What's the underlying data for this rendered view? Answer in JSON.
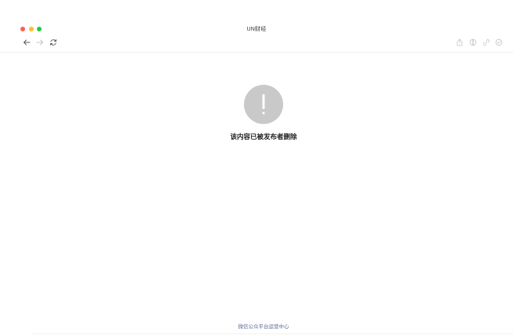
{
  "window": {
    "title": "UN财经",
    "traffic_colors": {
      "close": "#fe5f57",
      "minimize": "#febc2e",
      "maximize": "#28c840"
    }
  },
  "toolbar": {
    "icons": [
      "back-arrow-icon",
      "forward-arrow-icon",
      "reload-icon",
      "share-icon",
      "open-in-browser-icon",
      "copy-link-icon",
      "more-icon"
    ]
  },
  "content": {
    "message": "该内容已被发布者删除",
    "warning_symbol": "!",
    "warning_color": "#c9c9c9"
  },
  "footer": {
    "link_text": "微信公众平台运营中心",
    "link_color": "#576b95"
  }
}
